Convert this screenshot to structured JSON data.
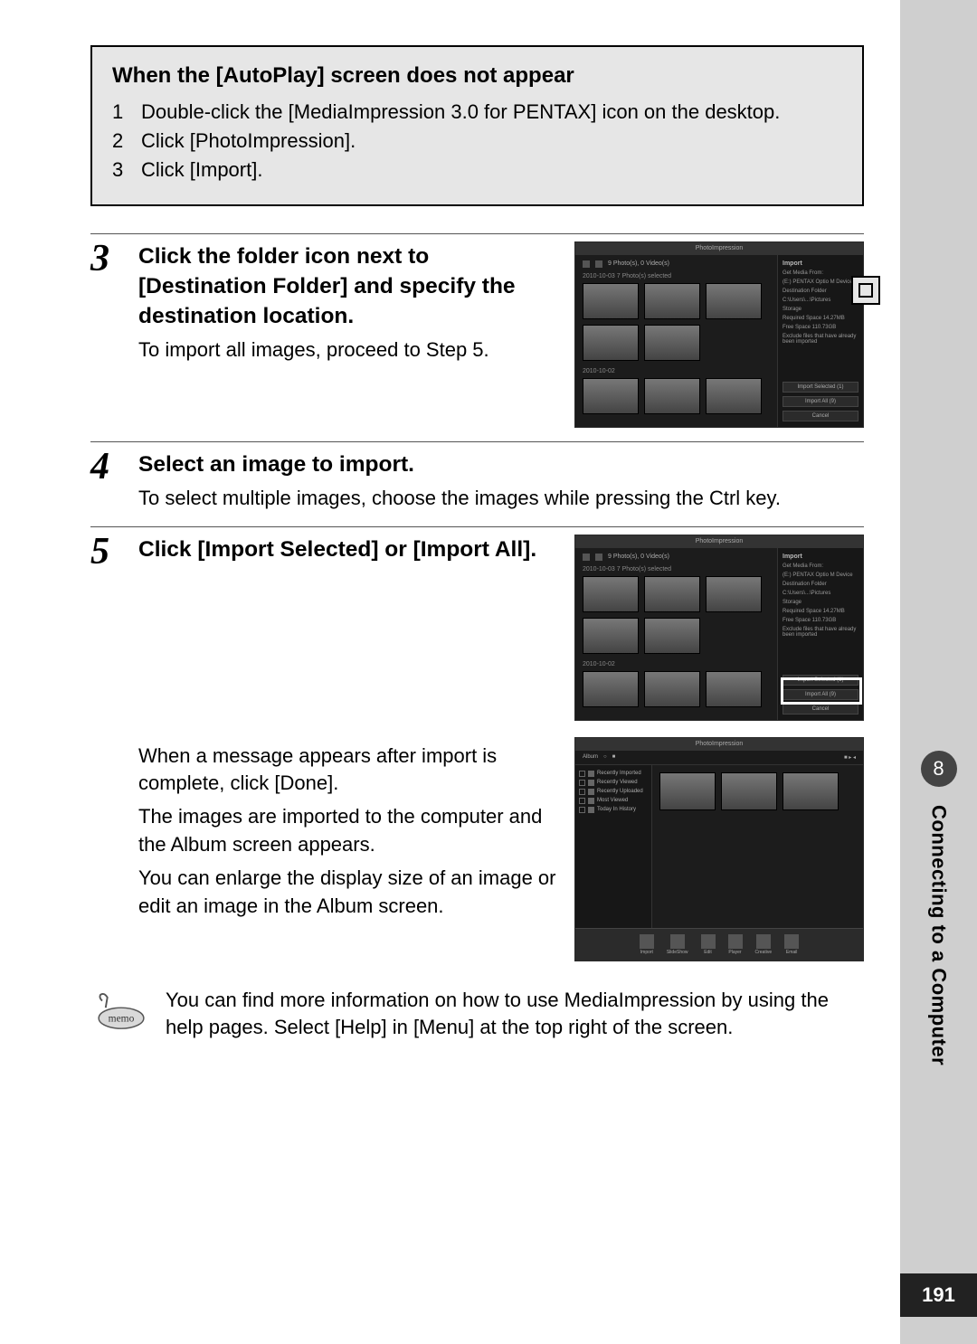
{
  "chapter": {
    "number": "8",
    "title": "Connecting to a Computer"
  },
  "page_number": "191",
  "infobox": {
    "title": "When the [AutoPlay] screen does not appear",
    "items": [
      {
        "n": "1",
        "text": "Double-click the [MediaImpression 3.0 for PENTAX] icon on the desktop."
      },
      {
        "n": "2",
        "text": "Click [PhotoImpression]."
      },
      {
        "n": "3",
        "text": "Click [Import]."
      }
    ]
  },
  "steps": {
    "s3": {
      "num": "3",
      "title": "Click the folder icon next to [Destination Folder] and specify the destination location.",
      "desc": "To import all images, proceed to Step 5."
    },
    "s4": {
      "num": "4",
      "title": "Select an image to import.",
      "desc": "To select multiple images, choose the images while pressing the Ctrl key."
    },
    "s5": {
      "num": "5",
      "title": "Click [Import Selected] or [Import All].",
      "after1": "When a message appears after import is complete, click [Done].",
      "after2": "The images are imported to the computer and the Album screen appears.",
      "after3": "You can enlarge the display size of an image or edit an image in the Album screen."
    }
  },
  "memo": "You can find more information on how to use MediaImpression by using the help pages. Select [Help] in [Menu] at the top right of the screen.",
  "screenshot": {
    "app_title": "PhotoImpression",
    "import_panel_title": "Import",
    "get_media_from": "Get Media From:",
    "device": "(E:) PENTAX Optio M Device",
    "dest_label": "Destination Folder",
    "dest_path": "C:\\Users\\...\\Pictures",
    "storage_label": "Storage",
    "storage_required": "Required Space 14.27MB",
    "storage_free": "Free Space 110.73GB",
    "exclude": "Exclude files that have already been imported",
    "btn_sel": "Import Selected (1)",
    "btn_all": "Import All (9)",
    "btn_cancel": "Cancel",
    "crumbs": "9 Photo(s), 0 Video(s)",
    "date1": "2010-10-03  7 Photo(s) selected",
    "date2": "2010-10-02"
  },
  "album": {
    "title": "PhotoImpression",
    "side_header": "Album",
    "items": [
      "Recently Imported",
      "Recently Viewed",
      "Recently Uploaded",
      "Most Viewed",
      "Today In History"
    ],
    "tools": [
      "Import",
      "SlideShow",
      "Edit",
      "Player",
      "Creative",
      "Email"
    ]
  }
}
